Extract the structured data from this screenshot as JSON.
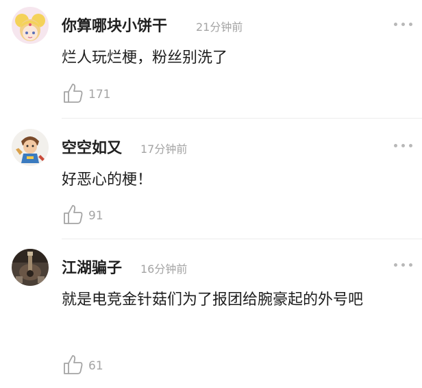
{
  "comments": [
    {
      "username": "你算哪块小饼干",
      "time": "21分钟前",
      "text": "烂人玩烂梗，粉丝别洗了",
      "likes": "171",
      "avatar_icon": "sailor-moon-avatar-icon"
    },
    {
      "username": "空空如又",
      "time": "17分钟前",
      "text": "好恶心的梗！",
      "likes": "91",
      "avatar_icon": "cartoon-hero-avatar-icon"
    },
    {
      "username": "江湖骗子",
      "time": "16分钟前",
      "text": "就是电竞金针菇们为了报团给腕豪起的外号吧",
      "likes": "61",
      "avatar_icon": "dark-guitar-avatar-icon"
    }
  ],
  "colors": {
    "name": "#1f1f1f",
    "meta": "#a4a4a4",
    "divider": "#ececec"
  }
}
